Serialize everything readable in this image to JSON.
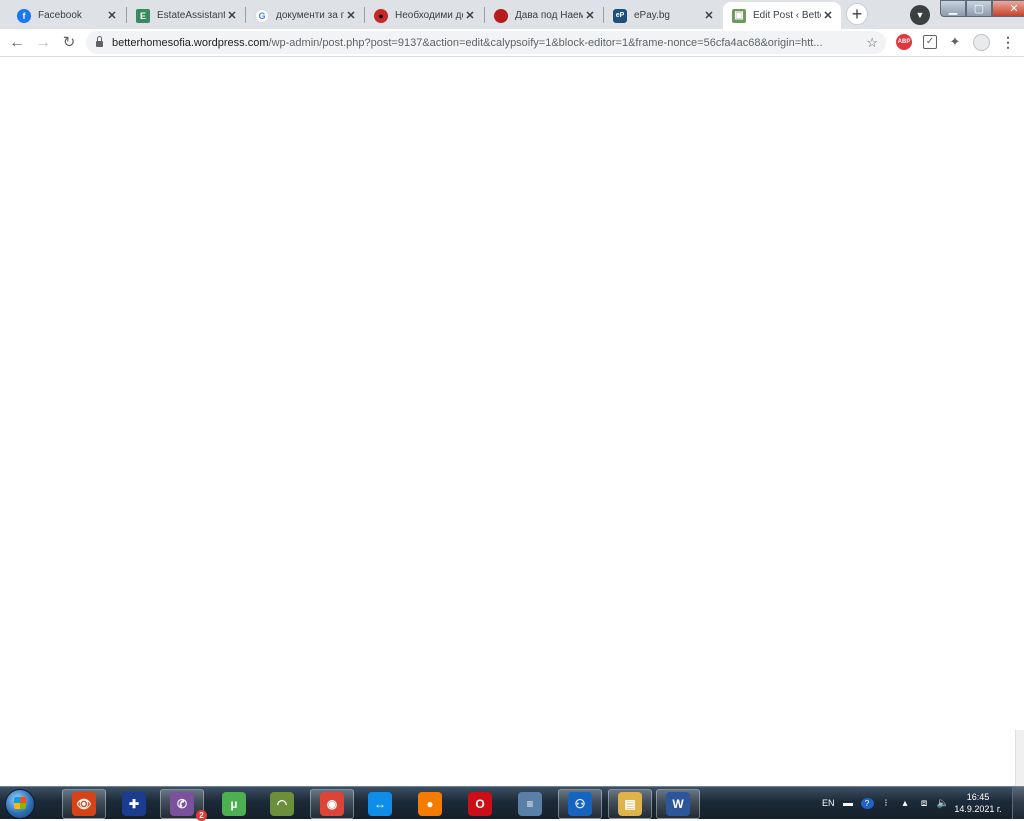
{
  "browser": {
    "tabs": [
      {
        "title": "Facebook",
        "icon": "facebook-icon",
        "favicon_text": "f",
        "color": "#1877f2",
        "active": false
      },
      {
        "title": "EstateAssistant",
        "icon": "estateassistant-icon",
        "favicon_text": "E",
        "color": "#3a8a5f",
        "active": false
      },
      {
        "title": "документи за п",
        "icon": "google-icon",
        "favicon_text": "G",
        "color": "#4285f4",
        "active": false
      },
      {
        "title": "Необходими до",
        "icon": "ladybug-icon",
        "favicon_text": "●",
        "color": "#c62828",
        "active": false
      },
      {
        "title": "Дава под Наем",
        "icon": "red-dot-icon",
        "favicon_text": "",
        "color": "#b71c1c",
        "active": false
      },
      {
        "title": "ePay.bg",
        "icon": "epay-icon",
        "favicon_text": "eP",
        "color": "#1f4f7a",
        "active": false
      },
      {
        "title": "Edit Post ‹ Bette",
        "icon": "wordpress-post-icon",
        "favicon_text": "▣",
        "color": "#6f9a5e",
        "active": true
      }
    ],
    "new_tab_label": "+",
    "url_host": "betterhomesofia.wordpress.com",
    "url_path": "/wp-admin/post.php?post=9137&action=edit&calypsoify=1&block-editor=1&frame-nonce=56cfa4ac68&origin=htt...",
    "extensions": {
      "abp_label": "ABP"
    }
  },
  "taskbar": {
    "apps": [
      {
        "name": "eye-app-icon",
        "glyph": "👁",
        "color": "#d84315",
        "pinned": true
      },
      {
        "name": "uk-flag-icon",
        "glyph": "✚",
        "color": "#1a3d8f",
        "pinned": false
      },
      {
        "name": "viber-icon",
        "glyph": "✆",
        "color": "#7b519d",
        "pinned": true,
        "badge": "2"
      },
      {
        "name": "utorrent-icon",
        "glyph": "µ",
        "color": "#4caf50",
        "pinned": false
      },
      {
        "name": "network-app-icon",
        "glyph": "◠",
        "color": "#6b8f3a",
        "pinned": false
      },
      {
        "name": "chrome-icon",
        "glyph": "◉",
        "color": "#db4437",
        "pinned": true
      },
      {
        "name": "teamviewer-icon",
        "glyph": "↔",
        "color": "#0e8ee9",
        "pinned": false
      },
      {
        "name": "orange-ball-icon",
        "glyph": "●",
        "color": "#f57c00",
        "pinned": false
      },
      {
        "name": "opera-icon",
        "glyph": "O",
        "color": "#cc0f16",
        "pinned": false
      },
      {
        "name": "lines-app-icon",
        "glyph": "≡",
        "color": "#5a7fa8",
        "pinned": false
      },
      {
        "name": "bluetooth-app-icon",
        "glyph": "⚇",
        "color": "#1565c0",
        "pinned": true
      },
      {
        "name": "file-explorer-icon",
        "glyph": "▤",
        "color": "#e0b34a",
        "pinned": true
      },
      {
        "name": "word-icon",
        "glyph": "W",
        "color": "#2b579a",
        "pinned": true
      }
    ],
    "language": "EN",
    "time": "16:45",
    "date": "14.9.2021 г."
  }
}
